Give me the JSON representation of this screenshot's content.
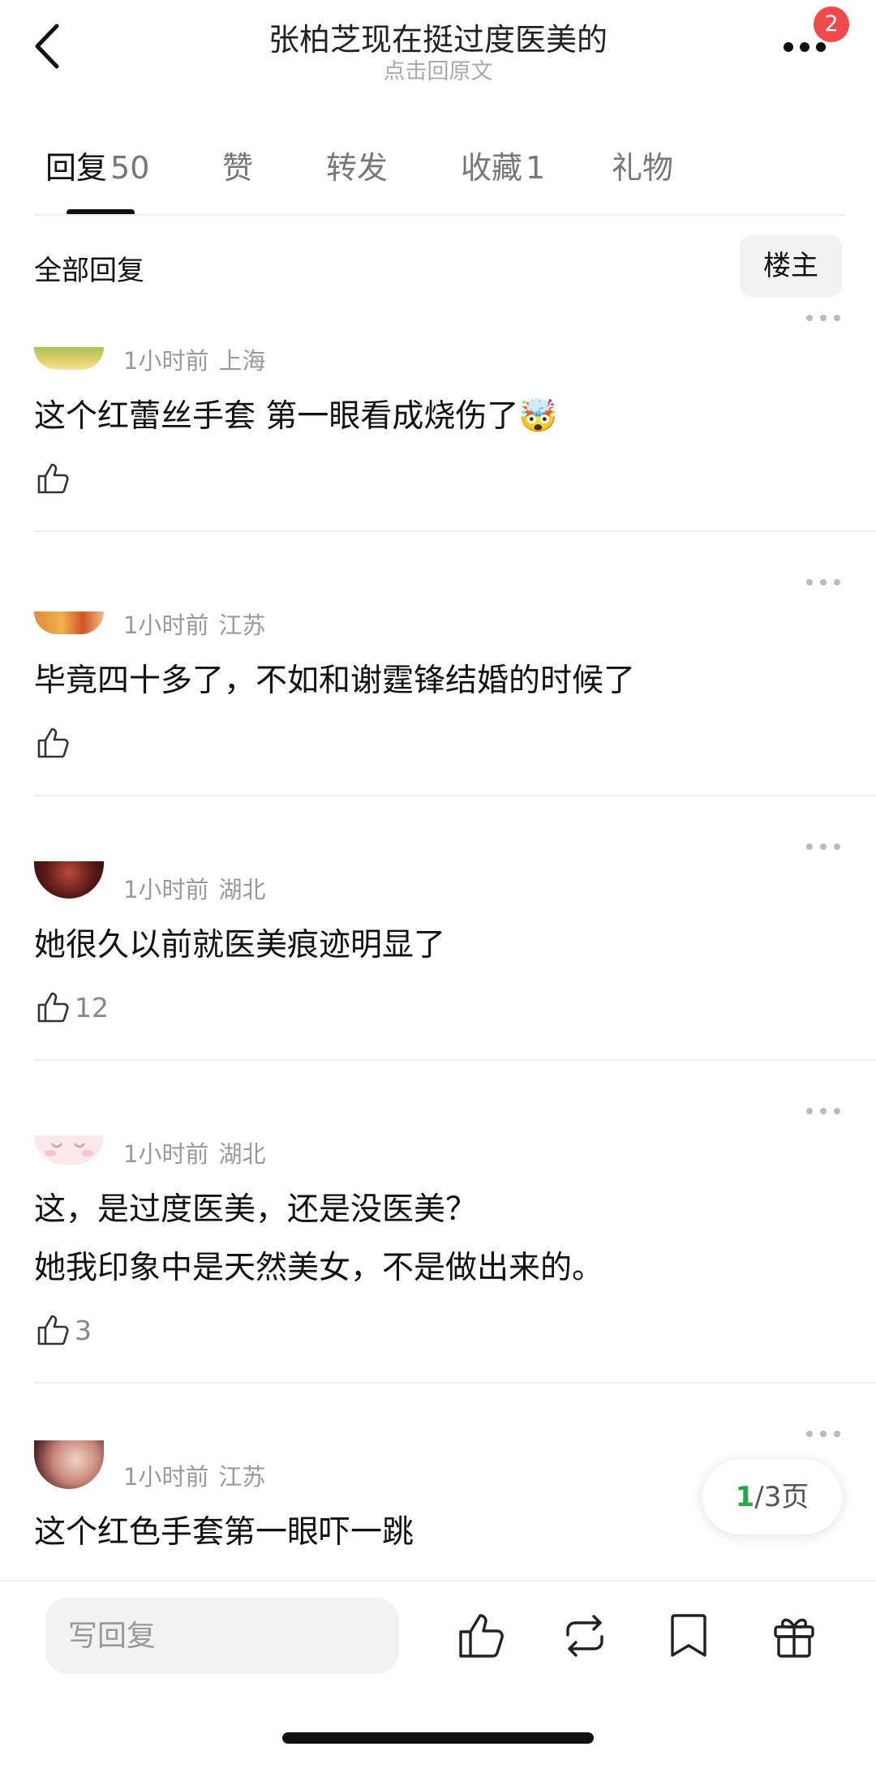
{
  "header": {
    "title": "张柏芝现在挺过度医美的",
    "subtitle": "点击回原文",
    "notification_count": "2"
  },
  "tabs": [
    {
      "label": "回复",
      "count": "50",
      "active": true
    },
    {
      "label": "赞",
      "count": ""
    },
    {
      "label": "转发",
      "count": ""
    },
    {
      "label": "收藏",
      "count": "1"
    },
    {
      "label": "礼物",
      "count": ""
    }
  ],
  "filter": {
    "label": "全部回复",
    "op_button": "楼主"
  },
  "comments": [
    {
      "time": "1小时前",
      "location": "上海",
      "text": "这个红蕾丝手套 第一眼看成烧伤了🤯",
      "likes": ""
    },
    {
      "time": "1小时前",
      "location": "江苏",
      "text": "毕竟四十多了，不如和谢霆锋结婚的时候了",
      "likes": ""
    },
    {
      "time": "1小时前",
      "location": "湖北",
      "text": "她很久以前就医美痕迹明显了",
      "likes": "12"
    },
    {
      "time": "1小时前",
      "location": "湖北",
      "text": "这，是过度医美，还是没医美？",
      "text2": "她我印象中是天然美女，不是做出来的。",
      "likes": "3"
    },
    {
      "time": "1小时前",
      "location": "江苏",
      "text": "这个红色手套第一眼吓一跳",
      "likes": ""
    }
  ],
  "pagination": {
    "current": "1",
    "total": "/3页"
  },
  "bottom_bar": {
    "reply_placeholder": "写回复"
  },
  "colors": {
    "accent_green": "#27a844",
    "badge_red": "#f24a4a"
  }
}
